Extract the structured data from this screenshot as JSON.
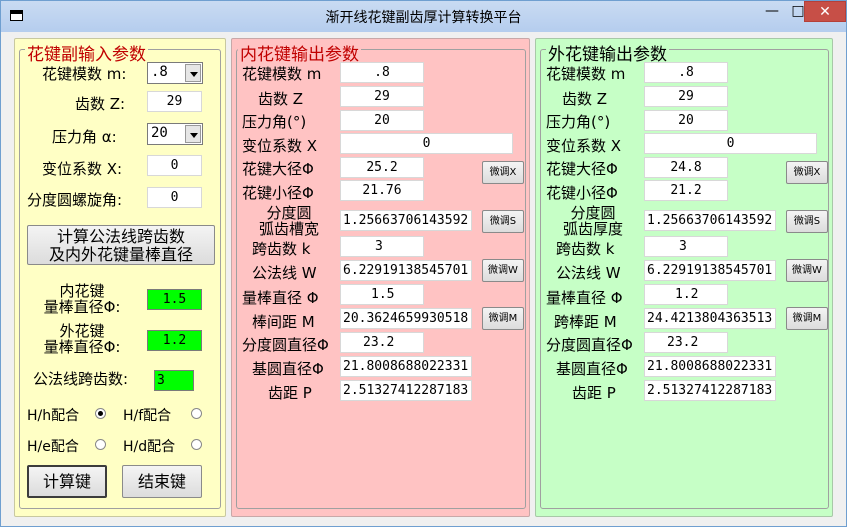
{
  "window": {
    "title": "渐开线花键副齿厚计算转换平台",
    "minimize_glyph": "—",
    "maximize_glyph": "□",
    "close_glyph": "✕",
    "close_color": "#c74f47"
  },
  "input_panel": {
    "legend": "花键副输入参数",
    "module_label": "花键模数 m:",
    "module_value": ".8",
    "teeth_label": "齿数 Z:",
    "teeth_value": "29",
    "pressure_angle_label": "压力角 α:",
    "pressure_angle_value": "20",
    "shift_label": "变位系数 X:",
    "shift_value": "0",
    "helix_label": "分度圆螺旋角:",
    "helix_value": "0",
    "calc_span_button_line1": "计算公法线跨齿数",
    "calc_span_button_line2": "及内外花键量棒直径",
    "inner_pin_label_line1": "内花键",
    "inner_pin_label_line2": "量棒直径Φ:",
    "inner_pin_value": "1.5",
    "outer_pin_label_line1": "外花键",
    "outer_pin_label_line2": "量棒直径Φ:",
    "outer_pin_value": "1.2",
    "span_teeth_label": "公法线跨齿数:",
    "span_teeth_value": "3",
    "fit_hh": "H/h配合",
    "fit_hf": "H/f配合",
    "fit_he": "H/e配合",
    "fit_hd": "H/d配合",
    "calculate_button": "计算键",
    "exit_button": "结束键"
  },
  "inner_panel": {
    "legend": "内花键输出参数",
    "module_label": "花键模数 m",
    "module_value": ".8",
    "teeth_label": "齿数  Z",
    "teeth_value": "29",
    "pressure_angle_label": "压力角(°)",
    "pressure_angle_value": "20",
    "shift_label": "变位系数 X",
    "shift_value": "0",
    "major_dia_label": "花键大径Φ",
    "major_dia_value": "25.2",
    "minor_dia_label": "花键小径Φ",
    "minor_dia_value": "21.76",
    "arc_label_line1": "分度圆",
    "arc_label_line2": "弧齿槽宽",
    "arc_value": "1.25663706143592",
    "span_label": "跨齿数 k",
    "span_value": "3",
    "wk_label": "公法线 W",
    "wk_value": "6.22919138545701",
    "pin_dia_label": "量棒直径 Φ",
    "pin_dia_value": "1.5",
    "pin_dist_label": "棒间距 M",
    "pin_dist_value": "20.3624659930518",
    "pitch_dia_label": "分度圆直径Φ",
    "pitch_dia_value": "23.2",
    "base_dia_label": "基圆直径Φ",
    "base_dia_value": "21.8008688022331",
    "pitch_label": "齿距 P",
    "pitch_value": "2.51327412287183",
    "adjust_x": "微调X",
    "adjust_s": "微调S",
    "adjust_w": "微调W",
    "adjust_m": "微调M"
  },
  "outer_panel": {
    "legend": "外花键输出参数",
    "module_label": "花键模数 m",
    "module_value": ".8",
    "teeth_label": "齿数  Z",
    "teeth_value": "29",
    "pressure_angle_label": "压力角(°)",
    "pressure_angle_value": "20",
    "shift_label": "变位系数 X",
    "shift_value": "0",
    "major_dia_label": "花键大径Φ",
    "major_dia_value": "24.8",
    "minor_dia_label": "花键小径Φ",
    "minor_dia_value": "21.2",
    "arc_label_line1": "分度圆",
    "arc_label_line2": "弧齿厚度",
    "arc_value": "1.25663706143592",
    "span_label": "跨齿数 k",
    "span_value": "3",
    "wk_label": "公法线 W",
    "wk_value": "6.22919138545701",
    "pin_dia_label": "量棒直径 Φ",
    "pin_dia_value": "1.2",
    "pin_dist_label": "跨棒距 M",
    "pin_dist_value": "24.4213804363513",
    "pitch_dia_label": "分度圆直径Φ",
    "pitch_dia_value": "23.2",
    "base_dia_label": "基圆直径Φ",
    "base_dia_value": "21.8008688022331",
    "pitch_label": "齿距 P",
    "pitch_value": "2.51327412287183",
    "adjust_x": "微调X",
    "adjust_s": "微调S",
    "adjust_w": "微调W",
    "adjust_m": "微调M"
  }
}
